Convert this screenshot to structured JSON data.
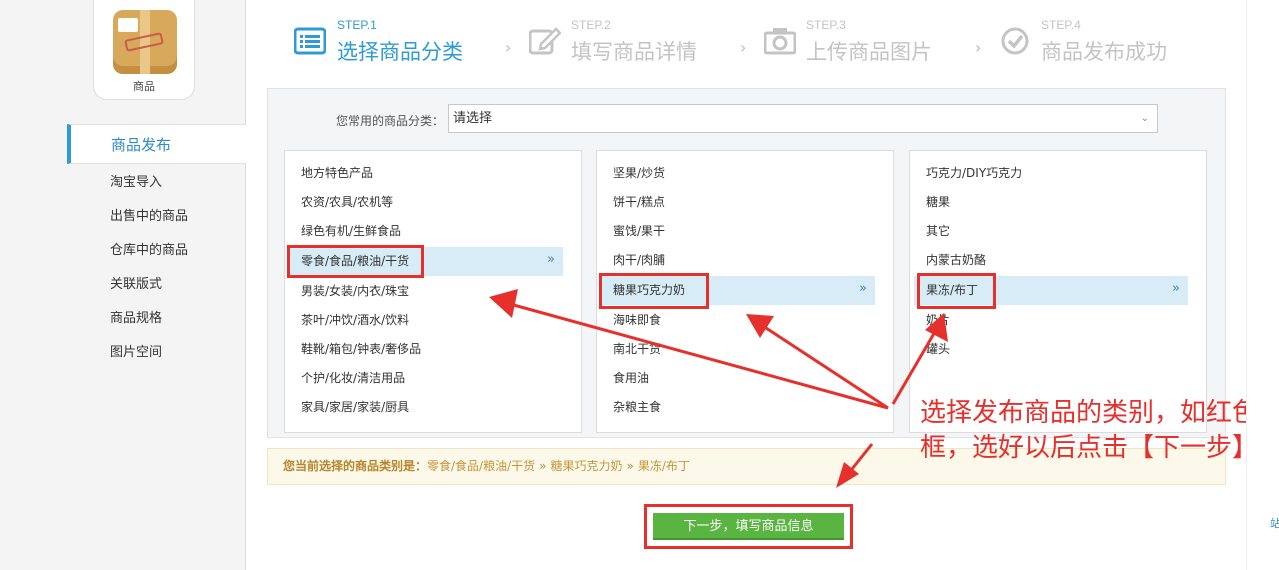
{
  "app": {
    "icon_label": "商品"
  },
  "sidebar": {
    "items": [
      {
        "label": "商品发布",
        "active": true
      },
      {
        "label": "淘宝导入"
      },
      {
        "label": "出售中的商品"
      },
      {
        "label": "仓库中的商品"
      },
      {
        "label": "关联版式"
      },
      {
        "label": "商品规格"
      },
      {
        "label": "图片空间"
      }
    ]
  },
  "steps": [
    {
      "num": "STEP.1",
      "title": "选择商品分类",
      "icon": "list-icon",
      "active": true
    },
    {
      "num": "STEP.2",
      "title": "填写商品详情",
      "icon": "edit-icon"
    },
    {
      "num": "STEP.3",
      "title": "上传商品图片",
      "icon": "camera-icon"
    },
    {
      "num": "STEP.4",
      "title": "商品发布成功",
      "icon": "check-circle-icon"
    }
  ],
  "frequent": {
    "label": "您常用的商品分类：",
    "value": "请选择"
  },
  "columns": [
    {
      "items": [
        "地方特色产品",
        "农资/农具/农机等",
        "绿色有机/生鲜食品",
        "零食/食品/粮油/干货",
        "男装/女装/内衣/珠宝",
        "茶叶/冲饮/酒水/饮料",
        "鞋靴/箱包/钟表/奢侈品",
        "个护/化妆/清洁用品",
        "家具/家居/家装/厨具"
      ],
      "selected": 3
    },
    {
      "items": [
        "坚果/炒货",
        "饼干/糕点",
        "蜜饯/果干",
        "肉干/肉脯",
        "糖果巧克力奶",
        "海味即食",
        "南北干货",
        "食用油",
        "杂粮主食"
      ],
      "selected": 4
    },
    {
      "items": [
        "巧克力/DIY巧克力",
        "糖果",
        "其它",
        "内蒙古奶酪",
        "果冻/布丁",
        "奶片",
        "罐头"
      ],
      "selected": 4
    }
  ],
  "current": {
    "label": "您当前选择的商品类别是：",
    "path": [
      "零食/食品/粮油/干货",
      "糖果巧克力奶",
      "果冻/布丁"
    ],
    "separator": "»"
  },
  "next_button": {
    "label": "下一步，填写商品信息"
  },
  "annotation": {
    "text": "选择发布商品的类别，如红色框，选好以后点击【下一步】"
  },
  "right_edge": {
    "text": "站"
  },
  "colors": {
    "accent": "#2f9bd4",
    "button": "#59b441",
    "annotation": "#e6302c",
    "current_text": "#c6953a"
  }
}
